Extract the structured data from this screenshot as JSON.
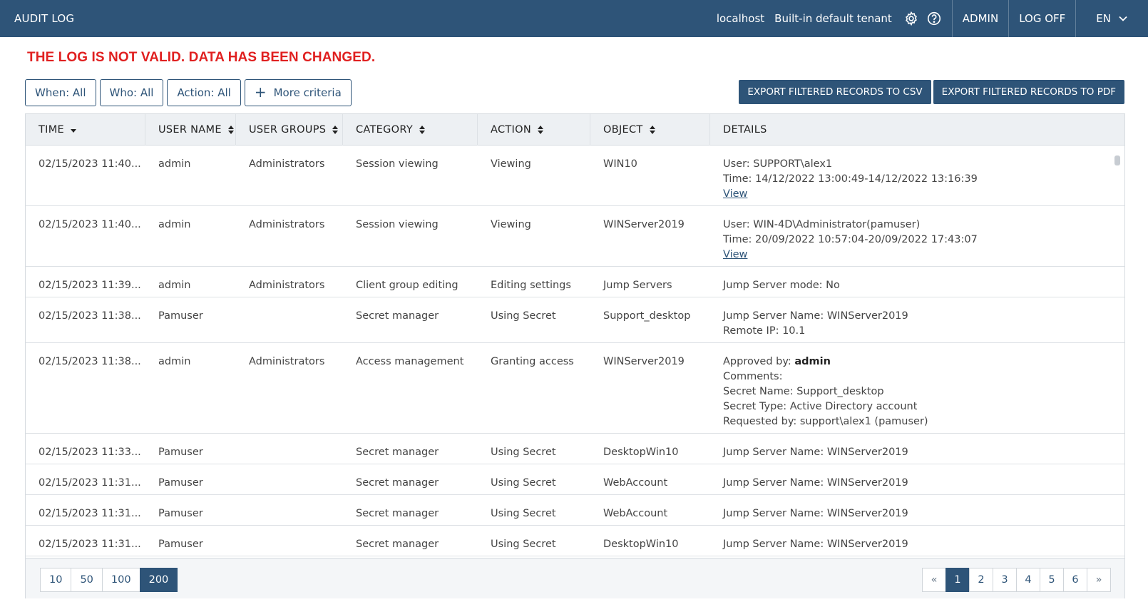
{
  "header": {
    "title": "AUDIT LOG",
    "host": "localhost",
    "tenant": "Built-in default tenant",
    "admin_label": "ADMIN",
    "logoff_label": "LOG OFF",
    "language": "EN",
    "icons": [
      "gear-icon",
      "help-icon",
      "chevron-down-icon"
    ]
  },
  "warning": "THE LOG IS NOT VALID. DATA HAS BEEN CHANGED.",
  "filters": {
    "when": "When: All",
    "who": "Who: All",
    "action": "Action: All",
    "more": "More criteria"
  },
  "exports": {
    "csv": "EXPORT FILTERED RECORDS TO CSV",
    "pdf": "EXPORT FILTERED RECORDS TO PDF"
  },
  "columns": [
    "TIME",
    "USER NAME",
    "USER GROUPS",
    "CATEGORY",
    "ACTION",
    "OBJECT",
    "DETAILS"
  ],
  "rows": [
    {
      "time": "02/15/2023 11:40...",
      "user": "admin",
      "groups": "Administrators",
      "category": "Session viewing",
      "action": "Viewing",
      "object": "WIN10",
      "details": [
        "User: SUPPORT\\alex1",
        "Time: 14/12/2022 13:00:49-14/12/2022 13:16:39"
      ],
      "link": "View"
    },
    {
      "time": "02/15/2023 11:40...",
      "user": "admin",
      "groups": "Administrators",
      "category": "Session viewing",
      "action": "Viewing",
      "object": "WINServer2019",
      "details": [
        "User: WIN-4D\\Administrator(pamuser)",
        "Time: 20/09/2022 10:57:04-20/09/2022 17:43:07"
      ],
      "link": "View"
    },
    {
      "time": "02/15/2023 11:39...",
      "user": "admin",
      "groups": "Administrators",
      "category": "Client group editing",
      "action": "Editing settings",
      "object": "Jump Servers",
      "details": [
        "Jump Server mode: No"
      ]
    },
    {
      "time": "02/15/2023 11:38...",
      "user": "Pamuser",
      "groups": "",
      "category": "Secret manager",
      "action": "Using Secret",
      "object": "Support_desktop",
      "details": [
        "Jump Server Name: WINServer2019",
        "Remote IP: 10.1"
      ]
    },
    {
      "time": "02/15/2023 11:38...",
      "user": "admin",
      "groups": "Administrators",
      "category": "Access management",
      "action": "Granting access",
      "object": "WINServer2019",
      "approved_label": "Approved by: ",
      "approved_by": "admin",
      "details": [
        "Comments:",
        "Secret Name: Support_desktop",
        "Secret Type: Active Directory account",
        "Requested by: support\\alex1 (pamuser)"
      ]
    },
    {
      "time": "02/15/2023 11:33...",
      "user": "Pamuser",
      "groups": "",
      "category": "Secret manager",
      "action": "Using Secret",
      "object": "DesktopWin10",
      "details": [
        "Jump Server Name: WINServer2019"
      ]
    },
    {
      "time": "02/15/2023 11:31...",
      "user": "Pamuser",
      "groups": "",
      "category": "Secret manager",
      "action": "Using Secret",
      "object": "WebAccount",
      "details": [
        "Jump Server Name: WINServer2019"
      ]
    },
    {
      "time": "02/15/2023 11:31...",
      "user": "Pamuser",
      "groups": "",
      "category": "Secret manager",
      "action": "Using Secret",
      "object": "WebAccount",
      "details": [
        "Jump Server Name: WINServer2019"
      ]
    },
    {
      "time": "02/15/2023 11:31...",
      "user": "Pamuser",
      "groups": "",
      "category": "Secret manager",
      "action": "Using Secret",
      "object": "DesktopWin10",
      "details": [
        "Jump Server Name: WINServer2019"
      ]
    }
  ],
  "page_sizes": [
    "10",
    "50",
    "100",
    "200"
  ],
  "page_size_selected": "200",
  "pager": {
    "prev": "«",
    "pages": [
      "1",
      "2",
      "3",
      "4",
      "5",
      "6"
    ],
    "current": "1",
    "next": "»"
  }
}
